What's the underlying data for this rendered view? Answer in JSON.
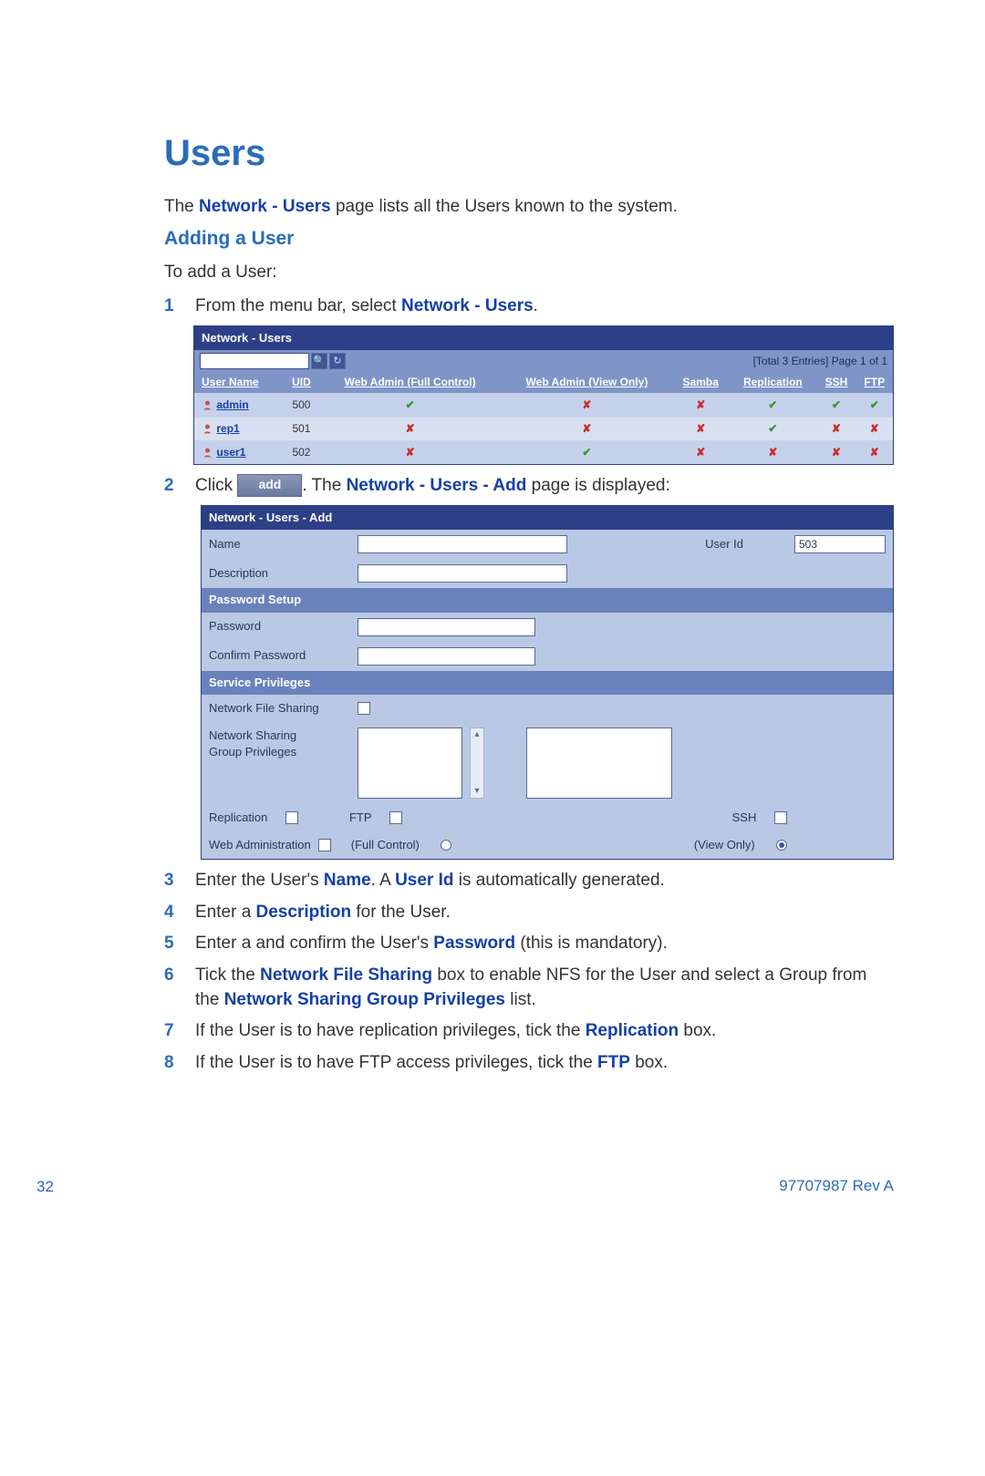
{
  "heading": "Users",
  "intro_pre": "The ",
  "intro_bold": "Network - Users",
  "intro_post": " page lists all the Users known to the system.",
  "subheading": "Adding a User",
  "lead": "To add a User:",
  "step1": {
    "pre": "From the menu bar, select ",
    "bold": "Network - Users",
    "post": "."
  },
  "users_table": {
    "title": "Network - Users",
    "page_info": "[Total 3 Entries] Page 1 of 1",
    "headers": [
      "User Name",
      "UID",
      "Web Admin (Full Control)",
      "Web Admin (View Only)",
      "Samba",
      "Replication",
      "SSH",
      "FTP"
    ],
    "rows": [
      {
        "name": "admin",
        "uid": "500",
        "flags": [
          "check",
          "cross",
          "cross",
          "check",
          "check",
          "check"
        ]
      },
      {
        "name": "rep1",
        "uid": "501",
        "flags": [
          "cross",
          "cross",
          "cross",
          "check",
          "cross",
          "cross"
        ]
      },
      {
        "name": "user1",
        "uid": "502",
        "flags": [
          "cross",
          "check",
          "cross",
          "cross",
          "cross",
          "cross"
        ]
      }
    ]
  },
  "step2": {
    "pre": "Click ",
    "btn": "add",
    "mid": ". The ",
    "bold": "Network - Users - Add",
    "post": " page is displayed:"
  },
  "add_form": {
    "title": "Network - Users - Add",
    "labels": {
      "name": "Name",
      "user_id": "User Id",
      "user_id_value": "503",
      "desc": "Description",
      "pwsetup": "Password Setup",
      "pw": "Password",
      "cpw": "Confirm Password",
      "privs": "Service Privileges",
      "nfs": "Network File Sharing",
      "nsgp1": "Network Sharing",
      "nsgp2": "Group Privileges",
      "replication": "Replication",
      "ftp": "FTP",
      "ssh": "SSH",
      "webadmin": "Web Administration",
      "fullctrl": "(Full Control)",
      "viewonly": "(View Only)"
    }
  },
  "step3": {
    "pre": "Enter the User's ",
    "b1": "Name",
    "mid": ". A ",
    "b2": "User Id",
    "post": " is automatically generated."
  },
  "step4": {
    "pre": "Enter a ",
    "b1": "Description",
    "post": " for the User."
  },
  "step5": {
    "pre": "Enter a and confirm the User's ",
    "b1": "Password",
    "post": " (this is mandatory)."
  },
  "step6": {
    "pre": "Tick the ",
    "b1": "Network File Sharing",
    "mid1": " box to enable NFS for the User and select a Group from the ",
    "b2": "Network Sharing Group Privileges",
    "post": " list."
  },
  "step7": {
    "pre": "If the User is to have replication privileges, tick the ",
    "b1": "Replication",
    "post": " box."
  },
  "step8": {
    "pre": "If the User is to have FTP access privileges, tick the ",
    "b1": "FTP",
    "post": " box."
  },
  "page_number": "32",
  "doc_rev": "97707987 Rev A",
  "nums": {
    "n1": "1",
    "n2": "2",
    "n3": "3",
    "n4": "4",
    "n5": "5",
    "n6": "6",
    "n7": "7",
    "n8": "8"
  }
}
